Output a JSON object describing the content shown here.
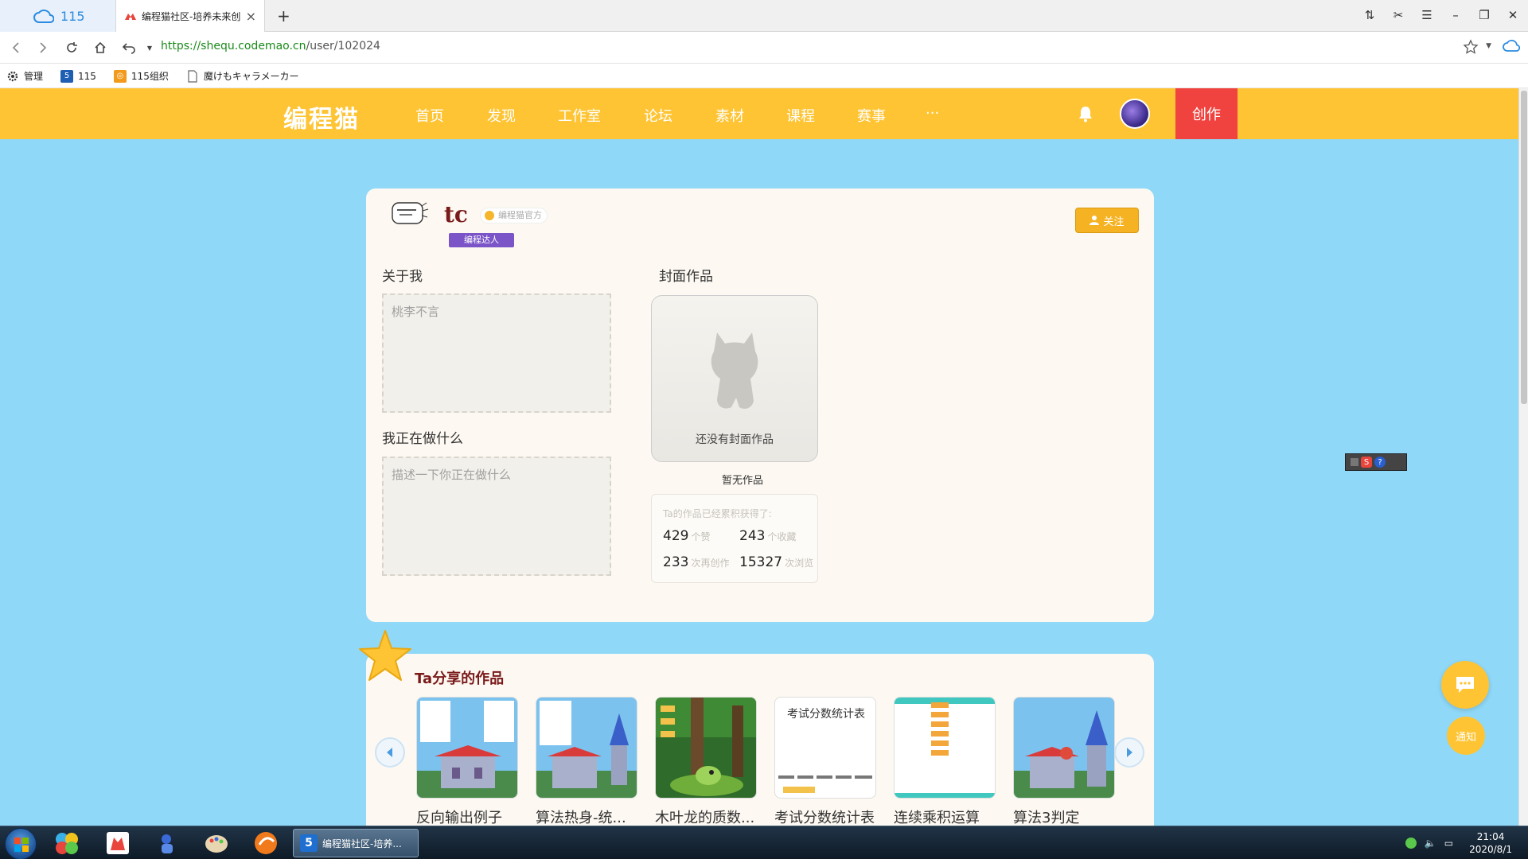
{
  "browser": {
    "cloud_tab_label": "115",
    "active_tab_title": "编程猫社区-培养未来创",
    "url_host": "https://shequ.codemao.cn",
    "url_path": "/user/102024"
  },
  "bookmarks": [
    {
      "label": "管理"
    },
    {
      "label": "115"
    },
    {
      "label": "115组织"
    },
    {
      "label": "魔けもキャラメーカー"
    }
  ],
  "site": {
    "logo": "编程猫",
    "nav": [
      "首页",
      "发现",
      "工作室",
      "论坛",
      "素材",
      "课程",
      "赛事",
      "···"
    ],
    "create_label": "创作"
  },
  "profile": {
    "username": "tc",
    "official_tag": "编程猫官方",
    "badge": "编程达人",
    "follow_label": "关注",
    "about_title": "关于我",
    "about_text": "桃李不言",
    "doing_title": "我正在做什么",
    "doing_placeholder": "描述一下你正在做什么",
    "cover_title": "封面作品",
    "cover_empty": "还没有封面作品",
    "no_works": "暂无作品",
    "stats_header": "Ta的作品已经累积获得了:",
    "stats": [
      {
        "value": "429",
        "unit": "个赞"
      },
      {
        "value": "243",
        "unit": "个收藏"
      },
      {
        "value": "233",
        "unit": "次再创作"
      },
      {
        "value": "15327",
        "unit": "次浏览"
      }
    ]
  },
  "works": {
    "title": "Ta分享的作品",
    "items": [
      {
        "title": "反向输出例子"
      },
      {
        "title": "算法热身-统..."
      },
      {
        "title": "木叶龙的质数..."
      },
      {
        "title": "考试分数统计表",
        "thumb_text": "考试分数统计表"
      },
      {
        "title": "连续乘积运算"
      },
      {
        "title": "算法3判定"
      }
    ]
  },
  "floating": {
    "notify_label": "通知"
  },
  "taskbar": {
    "browser_task": "编程猫社区-培养...",
    "time": "21:04",
    "date": "2020/8/1"
  },
  "colors": {
    "nav_yellow": "#fec433",
    "page_blue": "#8fd8f8",
    "create_red": "#f0433f",
    "card_bg": "#fdf9f2",
    "badge_purple": "#7b55c8"
  }
}
